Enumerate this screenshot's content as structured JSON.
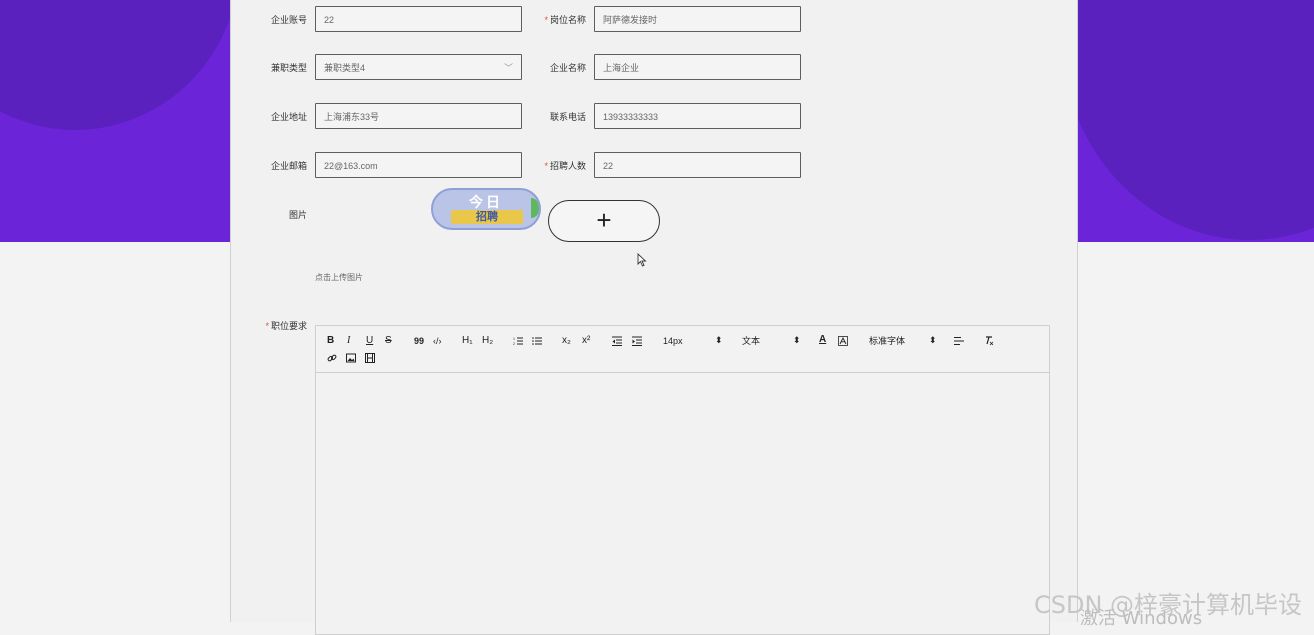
{
  "form": {
    "company_account": {
      "label": "企业账号",
      "value": "22"
    },
    "job_title": {
      "required_mark": "*",
      "label": "岗位名称",
      "value": "阿萨德发接时"
    },
    "job_type": {
      "label": "兼职类型",
      "value": "兼职类型4"
    },
    "company_name": {
      "label": "企业名称",
      "value": "上海企业"
    },
    "company_address": {
      "label": "企业地址",
      "value": "上海浦东33号"
    },
    "phone": {
      "label": "联系电话",
      "value": "13933333333"
    },
    "company_email": {
      "label": "企业邮箱",
      "value": "22@163.com"
    },
    "recruit_count": {
      "required_mark": "*",
      "label": "招聘人数",
      "value": "22"
    },
    "image": {
      "label": "图片",
      "upload_symbol": "+",
      "hint": "点击上传图片",
      "logo_text_top": "今日",
      "logo_text_band": "招聘"
    },
    "job_requirements": {
      "required_mark": "*",
      "label": "职位要求"
    }
  },
  "editor": {
    "bold": "B",
    "italic": "I",
    "underline": "U",
    "strike": "S",
    "quote": "99",
    "code": "‹/›",
    "h1": "H₁",
    "h2": "H₂",
    "subscript": "x₂",
    "superscript": "x²",
    "font_size": "14px",
    "text_type": "文本",
    "font_family": "标准字体",
    "color_a": "A",
    "icons": [
      "ordered-list-icon",
      "bullet-list-icon",
      "indent-decrease-icon",
      "indent-increase-icon",
      "background-color-icon",
      "align-icon",
      "clear-format-icon",
      "link-icon",
      "image-icon",
      "video-icon"
    ]
  },
  "overlays": {
    "watermark": "CSDN @梓豪计算机毕设",
    "activate": "激活 Windows"
  },
  "colors": {
    "background_purple": "#6c24d8",
    "required_red": "#e5453a",
    "input_border": "#5e5e5e"
  }
}
